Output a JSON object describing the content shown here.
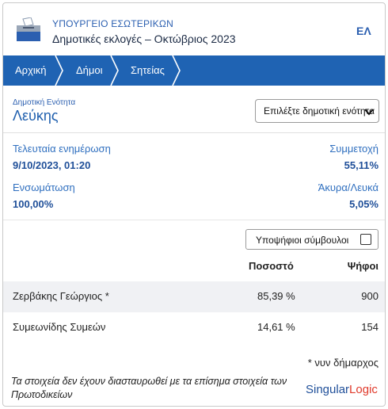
{
  "header": {
    "ministry": "ΥΠΟΥΡΓΕΙΟ ΕΣΩΤΕΡΙΚΩΝ",
    "election": "Δημοτικές εκλογές – Οκτώβριος 2023",
    "language": "ΕΛ",
    "logo_icon": "ballot-box-icon"
  },
  "breadcrumb": [
    "Αρχική",
    "Δήμοι",
    "Σητείας"
  ],
  "unit": {
    "label": "Δημοτική Ενότητα",
    "name": "Λεύκης",
    "select_value": "Επιλέξτε δημοτική ενότητα"
  },
  "stats": {
    "updated_label": "Τελευταία ενημέρωση",
    "updated_value": "9/10/2023, 01:20",
    "turnout_label": "Συμμετοχή",
    "turnout_value": "55,11%",
    "integration_label": "Ενσωμάτωση",
    "integration_value": "100,00%",
    "invalid_label": "Άκυρα/Λευκά",
    "invalid_value": "5,05%"
  },
  "council_toggle": {
    "label": "Υποψήφιοι σύμβουλοι",
    "checked": false
  },
  "table": {
    "headers": {
      "percent": "Ποσοστό",
      "votes": "Ψήφοι"
    },
    "rows": [
      {
        "name": "Ζερβάκης Γεώργιος *",
        "percent": "85,39 %",
        "votes": "900"
      },
      {
        "name": "Συμεωνίδης Συμεών",
        "percent": "14,61 %",
        "votes": "154"
      }
    ]
  },
  "footnote": "* νυν δήμαρχος",
  "disclaimer": "Τα στοιχεία δεν έχουν διασταυρωθεί με τα επίσημα στοιχεία των Πρωτοδικείων",
  "logo": {
    "part1": "Singular",
    "part2": "Logic"
  },
  "colors": {
    "accent": "#1f63b3",
    "brand_red": "#e03a2b"
  }
}
